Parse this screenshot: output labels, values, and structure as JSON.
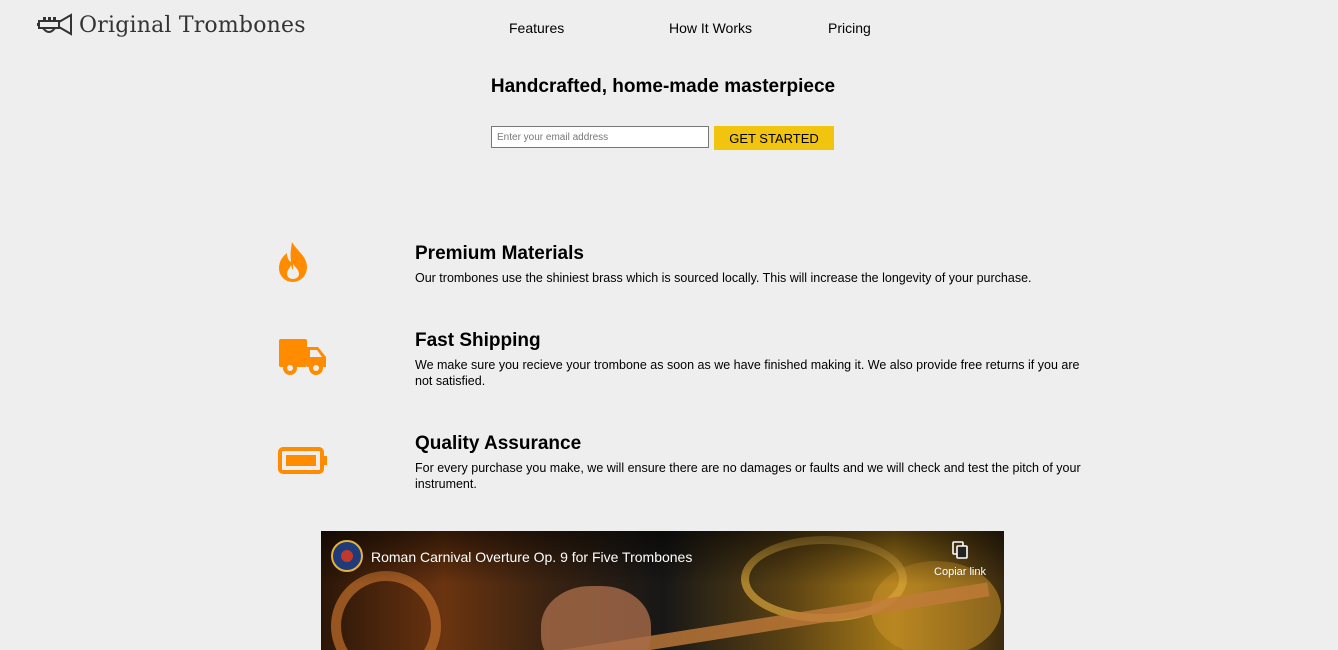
{
  "header": {
    "brand": "Original Trombones",
    "nav": [
      "Features",
      "How It Works",
      "Pricing"
    ]
  },
  "hero": {
    "title": "Handcrafted, home-made masterpiece",
    "email_placeholder": "Enter your email address",
    "cta_label": "GET STARTED"
  },
  "features": [
    {
      "icon": "fire-icon",
      "title": "Premium Materials",
      "description": "Our trombones use the shiniest brass which is sourced locally. This will increase the longevity of your purchase."
    },
    {
      "icon": "truck-icon",
      "title": "Fast Shipping",
      "description": "We make sure you recieve your trombone as soon as we have finished making it. We also provide free returns if you are not satisfied."
    },
    {
      "icon": "battery-icon",
      "title": "Quality Assurance",
      "description": "For every purchase you make, we will ensure there are no damages or faults and we will check and test the pitch of your instrument."
    }
  ],
  "video": {
    "title": "Roman Carnival Overture Op. 9 for Five Trombones",
    "copy_link_label": "Copiar link"
  },
  "colors": {
    "background": "#eeeeee",
    "accent": "#f1c40f",
    "icon": "#ff8c00"
  }
}
